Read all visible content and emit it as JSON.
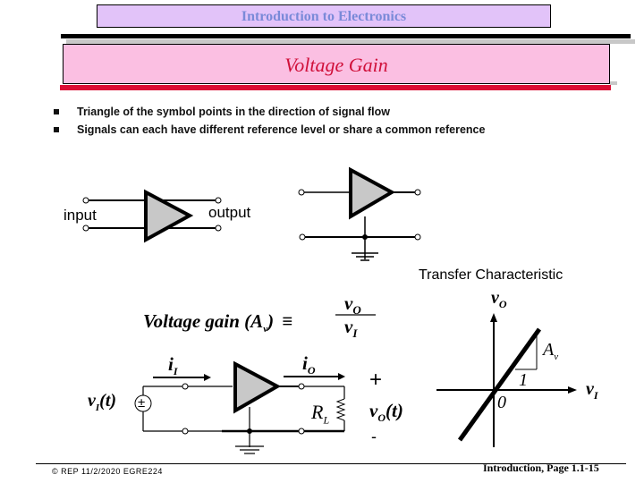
{
  "header": {
    "course_title": "Introduction to Electronics",
    "slide_title": "Voltage Gain"
  },
  "colors": {
    "course_box_bg": "#e2c3f9",
    "course_title_text": "#7a8ad8",
    "title_box_bg": "#fbbfe2",
    "title_text": "#d0103a",
    "accent_bar": "#dc0d35",
    "amp_fill": "#c8c8c8"
  },
  "bullets": [
    "Triangle of the symbol points in the direction of signal flow",
    "Signals can each have different reference level or share a common reference"
  ],
  "diagram_separate": {
    "input_label": "input",
    "output_label": "output"
  },
  "formula": {
    "lhs": "Voltage gain (A",
    "lhs_sub": "v",
    "lhs_close": ")",
    "equiv": "≡",
    "numerator": "v",
    "numerator_sub": "O",
    "denominator": "v",
    "denominator_sub": "I"
  },
  "circuit": {
    "source_label": "v",
    "source_sub": "I",
    "source_suffix": "(t)",
    "source_symbol": "±",
    "input_current": "i",
    "input_current_sub": "I",
    "output_current": "i",
    "output_current_sub": "O",
    "load_label": "R",
    "load_sub": "L",
    "output_voltage": "v",
    "output_voltage_sub": "O",
    "output_voltage_suffix": "(t)",
    "plus": "+",
    "minus": "-"
  },
  "transfer": {
    "title": "Transfer Characteristic",
    "y_axis": "v",
    "y_axis_sub": "O",
    "x_axis": "v",
    "x_axis_sub": "I",
    "origin": "0",
    "run_label": "1",
    "slope_label": "A",
    "slope_sub": "v"
  },
  "footer": {
    "left": "© REP  11/2/2020  EGRE224",
    "right": "Introduction, Page 1.1-15"
  }
}
